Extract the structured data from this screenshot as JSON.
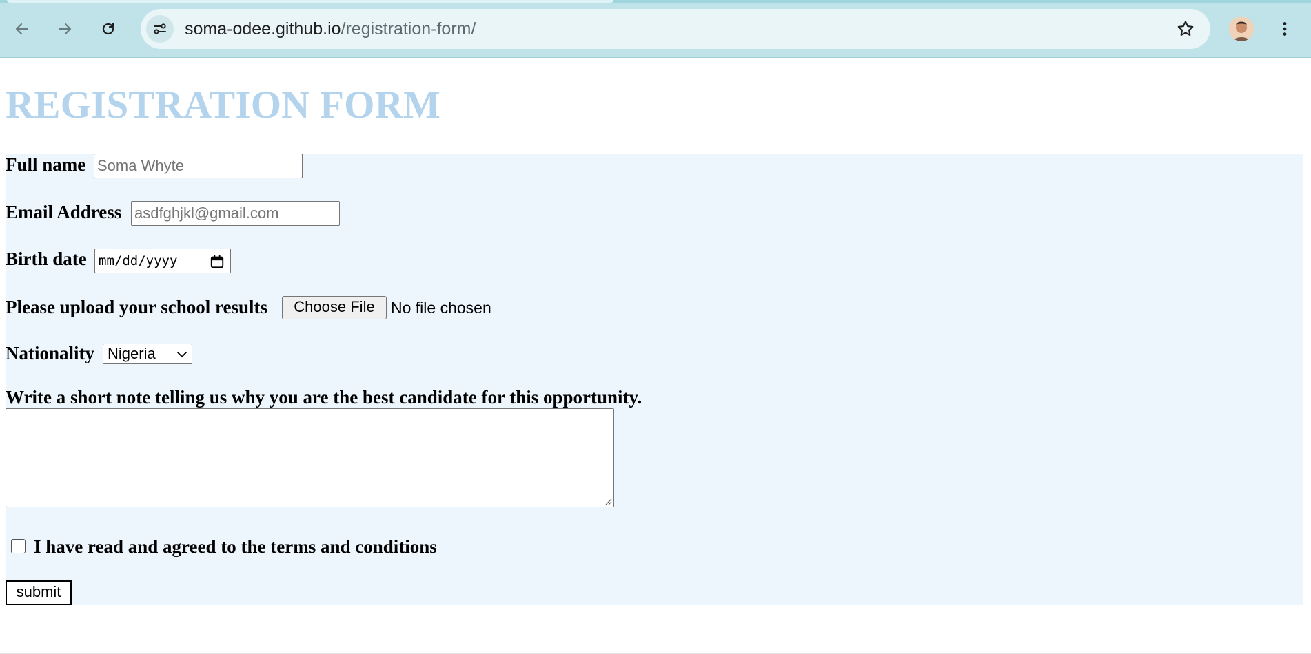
{
  "browser": {
    "url_host": "soma-odee.github.io",
    "url_path": "/registration-form/",
    "icons": [
      "back-arrow-icon",
      "forward-arrow-icon",
      "reload-icon",
      "site-info-icon",
      "bookmark-star-icon",
      "profile-avatar",
      "more-menu-icon"
    ]
  },
  "page": {
    "title": "REGISTRATION FORM",
    "title_color": "#b3d4ec",
    "form_background": "#eef6fd"
  },
  "form": {
    "full_name": {
      "label": "Full name",
      "placeholder": "Soma Whyte"
    },
    "email": {
      "label": "Email Address",
      "placeholder": "asdfghjkl@gmail.com"
    },
    "birth_date": {
      "label": "Birth date",
      "value": "mm/dd/yyyy"
    },
    "upload": {
      "label": "Please upload your school results",
      "button_label": "Choose File",
      "status": "No file chosen"
    },
    "nationality": {
      "label": "Nationality",
      "selected": "Nigeria"
    },
    "note": {
      "label": "Write a short note telling us why you are the best candidate for this opportunity.",
      "value": ""
    },
    "terms": {
      "label": "I have read and agreed to the terms and conditions",
      "checked": false
    },
    "submit_label": "submit"
  }
}
